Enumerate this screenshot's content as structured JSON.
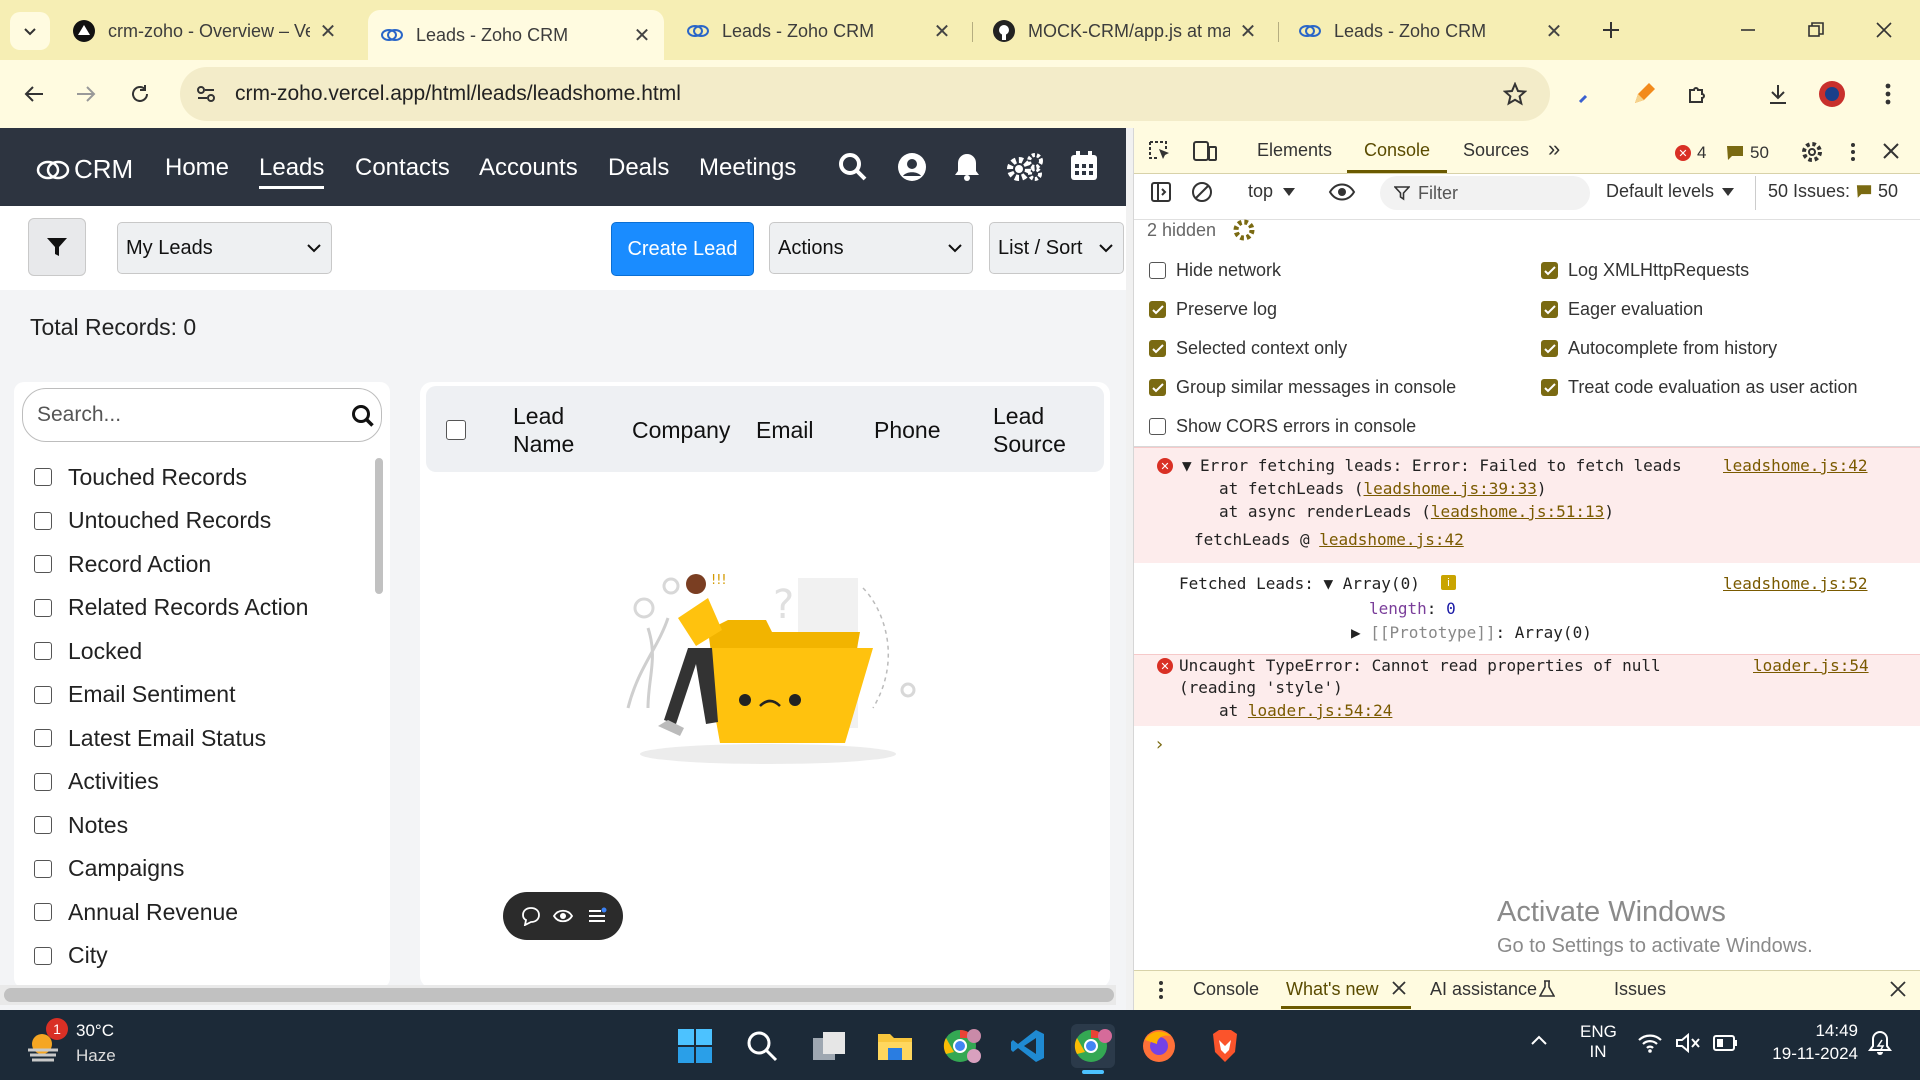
{
  "browser": {
    "tabs": [
      {
        "title": "crm-zoho - Overview – Ve",
        "active": false
      },
      {
        "title": "Leads - Zoho CRM",
        "active": true
      },
      {
        "title": "Leads - Zoho CRM",
        "active": false
      },
      {
        "title": "MOCK-CRM/app.js at ma",
        "active": false
      },
      {
        "title": "Leads - Zoho CRM",
        "active": false
      }
    ],
    "url": "crm-zoho.vercel.app/html/leads/leadshome.html"
  },
  "app": {
    "logo": "CRM",
    "nav": [
      "Home",
      "Leads",
      "Contacts",
      "Accounts",
      "Deals",
      "Meetings"
    ],
    "active_nav": "Leads",
    "view_select": "My Leads",
    "create_label": "Create Lead",
    "actions_select": "Actions",
    "listsort_select": "List / Sort",
    "total_records": "Total Records: 0",
    "search_placeholder": "Search...",
    "filters": [
      "Touched Records",
      "Untouched Records",
      "Record Action",
      "Related Records Action",
      "Locked",
      "Email Sentiment",
      "Latest Email Status",
      "Activities",
      "Notes",
      "Campaigns",
      "Annual Revenue",
      "City"
    ],
    "columns": {
      "c1": "Lead",
      "c1b": "Name",
      "c2": "Company",
      "c3": "Email",
      "c4": "Phone",
      "c5": "Lead",
      "c5b": "Source"
    }
  },
  "devtools": {
    "tabs": [
      "Elements",
      "Console",
      "Sources"
    ],
    "active_tab": "Console",
    "error_count": "4",
    "message_count": "50",
    "context": "top",
    "filter_placeholder": "Filter",
    "levels": "Default levels",
    "issues_label": "50 Issues:",
    "issues_count": "50",
    "hidden": "2 hidden",
    "settings_left": [
      {
        "label": "Hide network",
        "checked": false
      },
      {
        "label": "Preserve log",
        "checked": true
      },
      {
        "label": "Selected context only",
        "checked": true
      },
      {
        "label": "Group similar messages in console",
        "checked": true
      },
      {
        "label": "Show CORS errors in console",
        "checked": false
      }
    ],
    "settings_right": [
      {
        "label": "Log XMLHttpRequests",
        "checked": true
      },
      {
        "label": "Eager evaluation",
        "checked": true
      },
      {
        "label": "Autocomplete from history",
        "checked": true
      },
      {
        "label": "Treat code evaluation as user action",
        "checked": true
      }
    ],
    "messages": {
      "err1": "Error fetching leads: Error: Failed to fetch leads",
      "err1_src": "leadshome.js:42",
      "err1_l2a": "at fetchLeads (",
      "err1_l2link": "leadshome.js:39:33",
      "err1_l3a": "at async renderLeads (",
      "err1_l3link": "leadshome.js:51:13",
      "err1_l4a": "fetchLeads @ ",
      "err1_l4link": "leadshome.js:42",
      "log_a": "Fetched Leads: ",
      "log_b": "Array(0)",
      "log_src": "leadshome.js:52",
      "log_len_key": "length",
      "log_len_val": "0",
      "log_proto": "[[Prototype]]",
      "log_proto_val": "Array(0)",
      "err2_l1": "Uncaught TypeError: Cannot read properties of null",
      "err2_l2": "(reading 'style')",
      "err2_src": "loader.js:54",
      "err2_l3a": "at ",
      "err2_l3link": "loader.js:54:24"
    },
    "drawer_tabs": [
      "Console",
      "What's new",
      "AI assistance",
      "Issues"
    ]
  },
  "watermark": {
    "title": "Activate Windows",
    "subtitle": "Go to Settings to activate Windows."
  },
  "taskbar": {
    "weather_temp": "30°C",
    "weather_desc": "Haze",
    "weather_badge": "1",
    "lang1": "ENG",
    "lang2": "IN",
    "time": "14:49",
    "date": "19-11-2024"
  }
}
